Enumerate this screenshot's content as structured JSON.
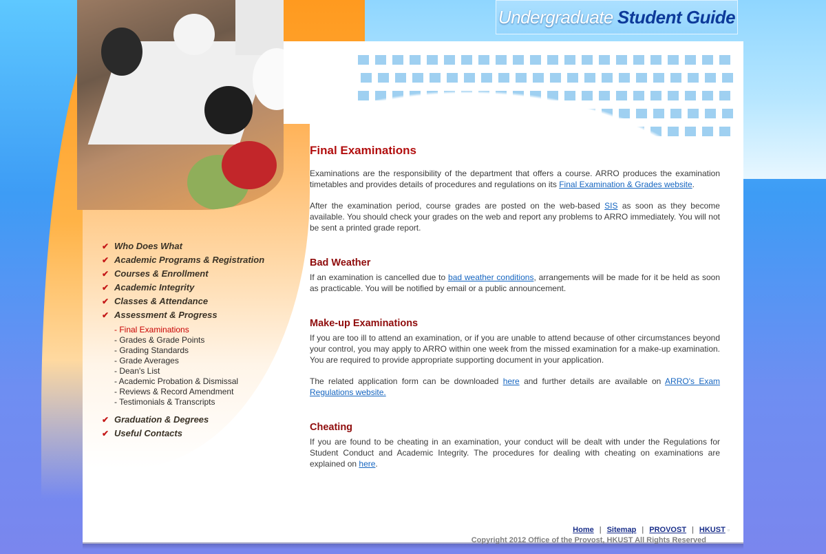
{
  "header": {
    "title_part1": "Undergraduate",
    "title_part2": "Student Guide"
  },
  "nav": {
    "items": [
      {
        "label": "Who Does What"
      },
      {
        "label": "Academic Programs & Registration"
      },
      {
        "label": "Courses & Enrollment"
      },
      {
        "label": "Academic Integrity"
      },
      {
        "label": "Classes & Attendance"
      },
      {
        "label": "Assessment & Progress"
      },
      {
        "label": "Graduation & Degrees"
      },
      {
        "label": "Useful Contacts"
      }
    ],
    "sub_items": [
      "- Final Examinations",
      "- Grades & Grade Points",
      "- Grading Standards",
      "- Grade Averages",
      "- Dean's List",
      "- Academic Probation & Dismissal",
      "- Reviews & Record Amendment",
      "- Testimonials & Transcripts"
    ]
  },
  "content": {
    "title": "Final Examinations",
    "intro1": {
      "before": "Examinations are the responsibility of the department that offers a course. ARRO produces the examination timetables and provides details of procedures and regulations on its ",
      "link": "Final Examination & Grades website",
      "after": "."
    },
    "intro2": {
      "before": "After the examination period, course grades are posted on the web-based ",
      "link": "SIS",
      "after": " as soon as they become available. You should check your grades on the web and report any problems to ARRO immediately. You will not be sent a printed grade report."
    },
    "bad_weather": {
      "heading": "Bad Weather",
      "before": "If an examination is cancelled due to ",
      "link": "bad weather conditions",
      "after": ", arrangements will be made for it be held as soon as practicable. You will be notified by email or a public announcement."
    },
    "makeup": {
      "heading": "Make-up Examinations",
      "p1": "If you are too ill to attend an examination, or if you are unable to attend because of other circumstances beyond your control, you may apply to ARRO within one week from the missed examination for a make-up examination. You are required to provide appropriate supporting document in your application.",
      "p2_before": "The related application form can be downloaded ",
      "p2_link1": "here",
      "p2_mid": " and further details are available on ",
      "p2_link2": "ARRO's Exam Regulations website.",
      "p2_after": ""
    },
    "cheating": {
      "heading": "Cheating",
      "before": "If you are found to be cheating in an examination, your conduct will be dealt with under the Regulations for Student Conduct and Academic Integrity. The procedures for dealing with cheating on examinations are explained on ",
      "link": "here",
      "after": "."
    }
  },
  "footer": {
    "links": [
      "Home",
      "Sitemap",
      "PROVOST",
      "HKUST"
    ],
    "separator": "|",
    "copyright": "Copyright 2012 Office of the Provost, HKUST   All Rights Reserved"
  },
  "colors": {
    "heading": "#b20f0f",
    "link": "#1565c0",
    "nav_active": "#c80000",
    "chevron": "#c41818"
  }
}
